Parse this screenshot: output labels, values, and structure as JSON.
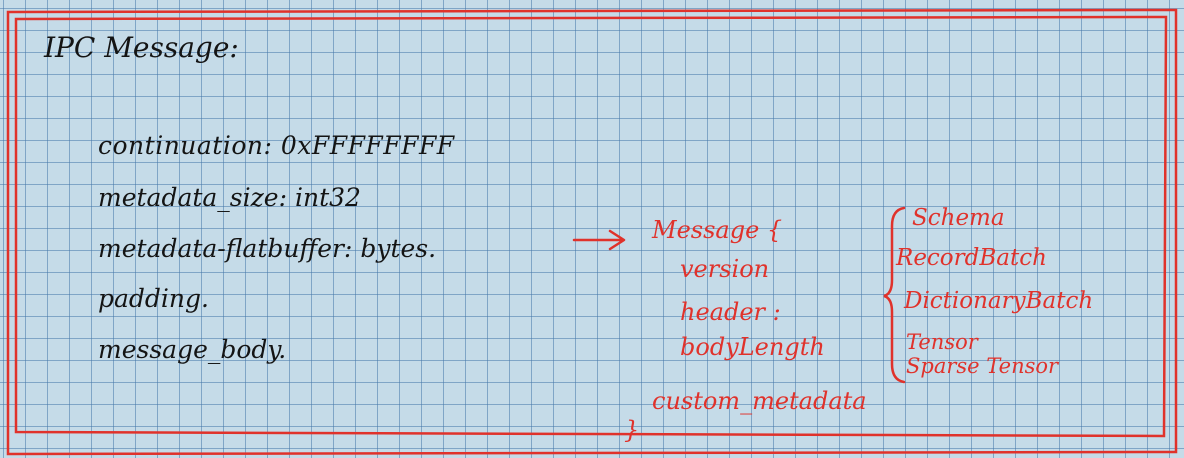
{
  "title": "IPC Message:",
  "fields": {
    "continuation": "continuation: 0xFFFFFFFF",
    "metadata_size": "metadata_size: int32",
    "metadata_flatbuffer": "metadata-flatbuffer: bytes.",
    "padding": "padding.",
    "message_body": "message_body."
  },
  "message_struct": {
    "open": "Message {",
    "version": "version",
    "header": "header :",
    "body_length": "bodyLength",
    "custom_metadata": "custom_metadata",
    "close": "}"
  },
  "header_types": [
    "Schema",
    "RecordBatch",
    "DictionaryBatch",
    "Tensor",
    "Sparse Tensor"
  ],
  "colors": {
    "ink": "#141414",
    "red_ink": "#e0322b",
    "paper": "#c5dbe8",
    "grid": "#4678aa"
  }
}
